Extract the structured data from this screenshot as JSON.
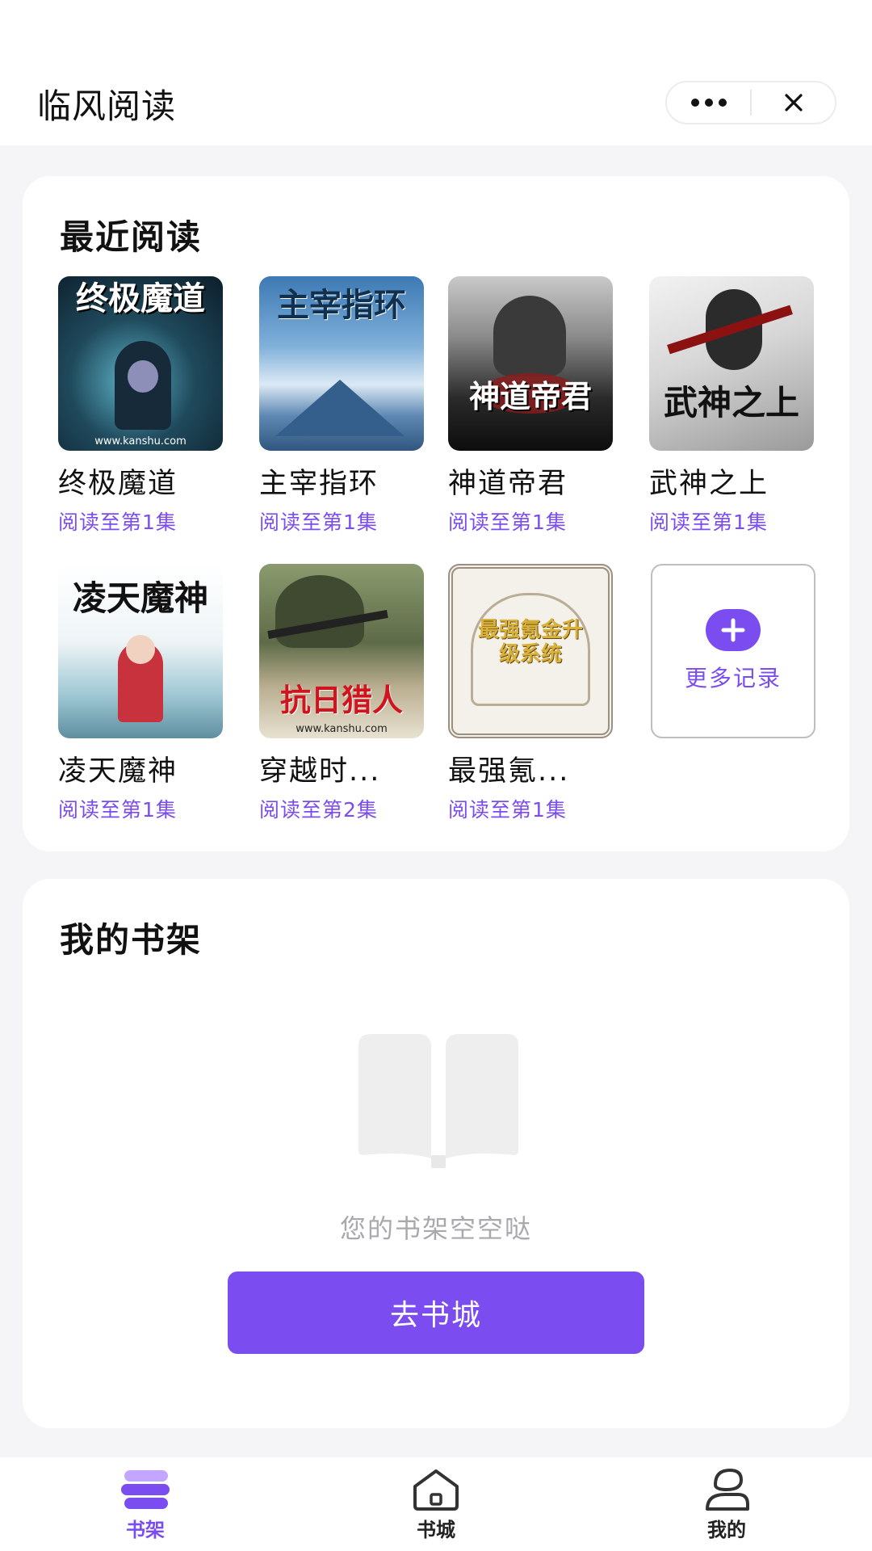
{
  "header": {
    "title": "临风阅读",
    "more_icon": "more-dots-icon",
    "close_icon": "close-icon"
  },
  "recent": {
    "title": "最近阅读",
    "books": [
      {
        "title": "终极魔道",
        "progress": "阅读至第1集",
        "cover_text": "终极魔道"
      },
      {
        "title": "主宰指环",
        "progress": "阅读至第1集",
        "cover_text": "主宰指环"
      },
      {
        "title": "神道帝君",
        "progress": "阅读至第1集",
        "cover_text": "神道帝君"
      },
      {
        "title": "武神之上",
        "progress": "阅读至第1集",
        "cover_text": "武神之上"
      },
      {
        "title": "凌天魔神",
        "progress": "阅读至第1集",
        "cover_text": "凌天魔神"
      },
      {
        "title": "穿越时...",
        "progress": "阅读至第2集",
        "cover_text": "抗日猎人"
      },
      {
        "title": "最强氪...",
        "progress": "阅读至第1集",
        "cover_text": "最强氪金升级系统"
      }
    ],
    "cover_site": "www.kanshu.com",
    "more_label": "更多记录"
  },
  "shelf": {
    "title": "我的书架",
    "empty_text": "您的书架空空哒",
    "button_label": "去书城"
  },
  "tabbar": {
    "tabs": [
      {
        "label": "书架",
        "icon": "bookshelf-icon",
        "active": true
      },
      {
        "label": "书城",
        "icon": "home-icon",
        "active": false
      },
      {
        "label": "我的",
        "icon": "user-icon",
        "active": false
      }
    ]
  },
  "colors": {
    "accent": "#7b4cf0",
    "background": "#f5f5f7"
  }
}
